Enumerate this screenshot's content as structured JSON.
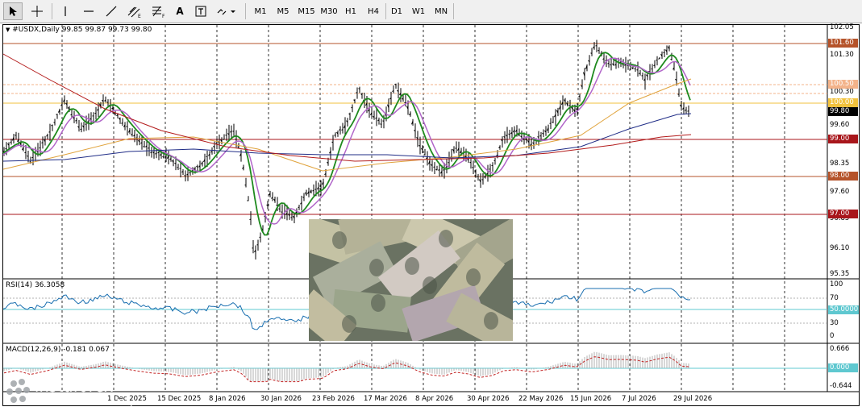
{
  "toolbar": {
    "text_tool": "A",
    "timeframes": [
      "M1",
      "M5",
      "M15",
      "M30",
      "H1",
      "H4",
      "D1",
      "W1",
      "MN"
    ]
  },
  "chart": {
    "header": "#USDX,Daily  99.85 99.87 99.73 99.80",
    "price_axis": [
      "102.05",
      "101.30",
      "100.30",
      "99.60",
      "98.35",
      "97.60",
      "96.85",
      "96.10",
      "95.35"
    ],
    "level_labels": [
      {
        "text": "101.60",
        "color": "#b5532a"
      },
      {
        "text": "100.50",
        "color": "#f3b38a"
      },
      {
        "text": "100.00",
        "color": "#f2c23d"
      },
      {
        "text": "99.80",
        "color": "#000000"
      },
      {
        "text": "99.00",
        "color": "#a8161b"
      },
      {
        "text": "98.00",
        "color": "#b5532a"
      },
      {
        "text": "97.00",
        "color": "#a8161b"
      }
    ],
    "date_axis": [
      "1 Dec 2025",
      "15 Dec 2025",
      "8 Jan 2026",
      "30 Jan 2026",
      "23 Feb 2026",
      "17 Mar 2026",
      "8 Apr 2026",
      "30 Apr 2026",
      "22 May 2026",
      "15 Jun 2026",
      "7 Jul 2026",
      "29 Jul 2026"
    ]
  },
  "rsi": {
    "label": "RSI(14) 36.3058",
    "axis": [
      "100",
      "70",
      "30",
      "0"
    ],
    "level_value": "50.0000"
  },
  "macd": {
    "label": "MACD(12,26,9) -0.181 0.067",
    "axis": [
      "0.666",
      "-0.644"
    ],
    "zero_value": "0.000"
  },
  "logo": {
    "name": "instaforex",
    "tagline": "Instant Forex Trading"
  },
  "colors": {
    "rsi_line": "#1a6fb0",
    "ma_green": "#1e8a1e",
    "ma_violet": "#b166c9",
    "ma_orange": "#e0a33c",
    "ma_navy": "#1f2c86",
    "ma_red": "#b31b1b",
    "level_cyan": "#5fc8d0"
  }
}
